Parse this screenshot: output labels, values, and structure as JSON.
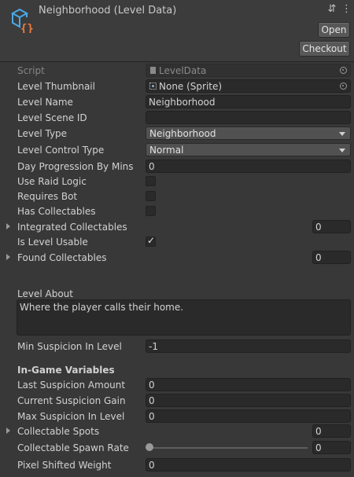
{
  "header": {
    "title": "Neighborhood (Level Data)",
    "open_label": "Open",
    "checkout_label": "Checkout",
    "icons": [
      "scriptable-object-icon",
      "preset-settings-icon",
      "kebab-menu-icon"
    ]
  },
  "fields": {
    "script": {
      "label": "Script",
      "value": "LevelData"
    },
    "thumbnail": {
      "label": "Level Thumbnail",
      "value": "None (Sprite)"
    },
    "level_name": {
      "label": "Level Name",
      "value": "Neighborhood"
    },
    "scene_id": {
      "label": "Level Scene ID",
      "value": ""
    },
    "level_type": {
      "label": "Level Type",
      "value": "Neighborhood"
    },
    "control_type": {
      "label": "Level Control Type",
      "value": "Normal"
    },
    "day_progression": {
      "label": "Day Progression By Mins",
      "value": "0"
    },
    "raid_logic": {
      "label": "Use Raid Logic",
      "checked": false
    },
    "requires_bot": {
      "label": "Requires Bot",
      "checked": false
    },
    "has_collectables": {
      "label": "Has Collectables",
      "checked": false
    },
    "integrated_collectables": {
      "label": "Integrated Collectables",
      "value": "0"
    },
    "level_usable": {
      "label": "Is Level Usable",
      "checked": true
    },
    "found_collectables": {
      "label": "Found Collectables",
      "value": "0"
    },
    "level_about": {
      "label": "Level About",
      "value": "Where the player calls their home."
    },
    "min_suspicion": {
      "label": "Min Suspicion In Level",
      "value": "-1"
    }
  },
  "ingame": {
    "heading": "In-Game Variables",
    "last_suspicion": {
      "label": "Last Suspicion Amount",
      "value": "0"
    },
    "current_suspicion_gain": {
      "label": "Current Suspicion Gain",
      "value": "0"
    },
    "max_suspicion": {
      "label": "Max Suspicion In Level",
      "value": "0"
    },
    "collectable_spots": {
      "label": "Collectable Spots",
      "value": "0"
    },
    "spawn_rate": {
      "label": "Collectable Spawn Rate",
      "value": "0",
      "slider_fraction": 0
    },
    "pixel_shifted_weight": {
      "label": "Pixel Shifted Weight",
      "value": "0"
    }
  },
  "colors": {
    "background": "#383838",
    "field": "#2a2a2a",
    "accent": "#f07a3c",
    "icon_blue": "#4aa9e6"
  }
}
